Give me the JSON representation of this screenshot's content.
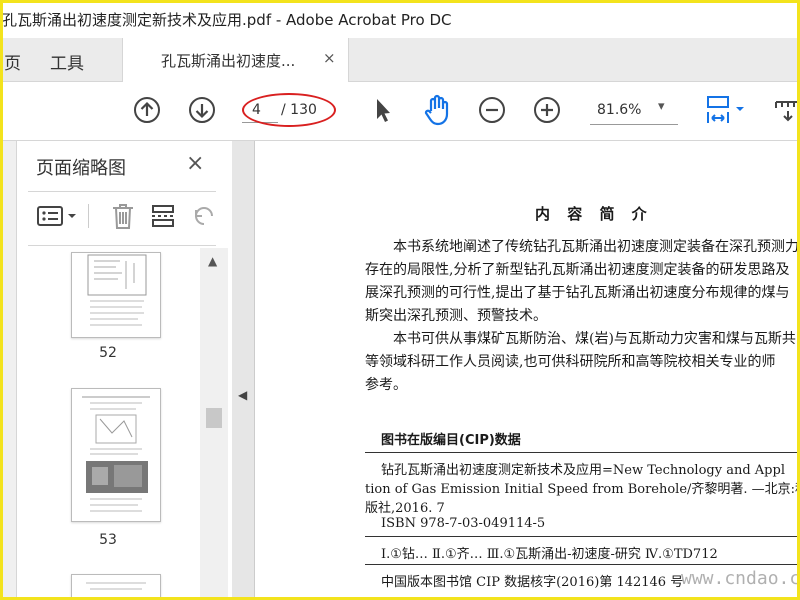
{
  "window": {
    "title": "孔瓦斯涌出初速度测定新技术及应用.pdf - Adobe Acrobat Pro DC"
  },
  "menu": {
    "items": [
      "页",
      "工具"
    ]
  },
  "tab": {
    "label": "孔瓦斯涌出初速度...",
    "close": "×"
  },
  "toolbar": {
    "page_current": "4",
    "page_total": "/ 130",
    "zoom": "81.6%"
  },
  "sidepanel": {
    "title": "页面缩略图",
    "close": "×",
    "thumbnails": [
      {
        "num": "52"
      },
      {
        "num": "53"
      }
    ]
  },
  "document": {
    "heading": "内 容 简 介",
    "para1": [
      "本书系统地阐述了传统钻孔瓦斯涌出初速度测定装备在深孔预测力",
      "存在的局限性,分析了新型钻孔瓦斯涌出初速度测定装备的研发思路及",
      "展深孔预测的可行性,提出了基于钻孔瓦斯涌出初速度分布规律的煤与",
      "斯突出深孔预测、预警技术。"
    ],
    "para2": [
      "本书可供从事煤矿瓦斯防治、煤(岩)与瓦斯动力灾害和煤与瓦斯共",
      "等领域科研工作人员阅读,也可供科研院所和高等院校相关专业的师",
      "参考。"
    ],
    "cip_title": "图书在版编目(CIP)数据",
    "cip_lines": [
      "钻孔瓦斯涌出初速度测定新技术及应用=New Technology and Appl",
      "tion of Gas Emission Initial Speed from Borehole/齐黎明著. —北京:科学",
      "版社,2016. 7",
      "ISBN 978-7-03-049114-5",
      "Ⅰ.①钻…  Ⅱ.①齐…  Ⅲ.①瓦斯涌出-初速度-研究  Ⅳ.①TD712",
      "中国版本图书馆 CIP 数据核字(2016)第 142146 号"
    ]
  },
  "watermark": "www.cndao.com",
  "colors": {
    "accent": "#1473e6",
    "annotation": "#d92020",
    "frame": "#f3e31d"
  }
}
